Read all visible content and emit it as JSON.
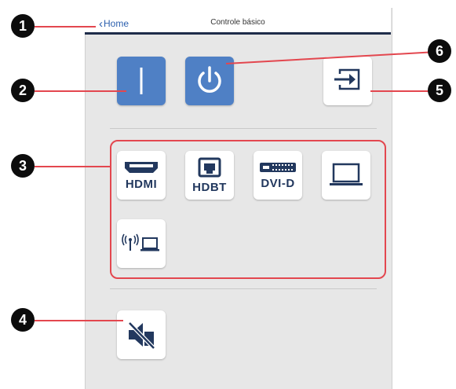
{
  "header": {
    "back_label": "Home",
    "title": "Controle básico"
  },
  "controls": {
    "av_mute_icon": "av-mute-icon",
    "power_icon": "power-icon",
    "source_search_icon": "source-search-icon"
  },
  "sources": [
    {
      "label": "HDMI",
      "icon": "hdmi-port-icon"
    },
    {
      "label": "HDBT",
      "icon": "hdbaset-port-icon"
    },
    {
      "label": "DVI-D",
      "icon": "dvi-port-icon"
    },
    {
      "label": "",
      "icon": "computer-icon"
    },
    {
      "label": "",
      "icon": "network-icon"
    }
  ],
  "audio": {
    "icon": "mute-audio-icon"
  },
  "callouts": [
    "1",
    "2",
    "3",
    "4",
    "5",
    "6"
  ],
  "colors": {
    "accent_blue": "#4f80c5",
    "callout_red": "#e3474f",
    "header_bar": "#1f2d4a"
  }
}
